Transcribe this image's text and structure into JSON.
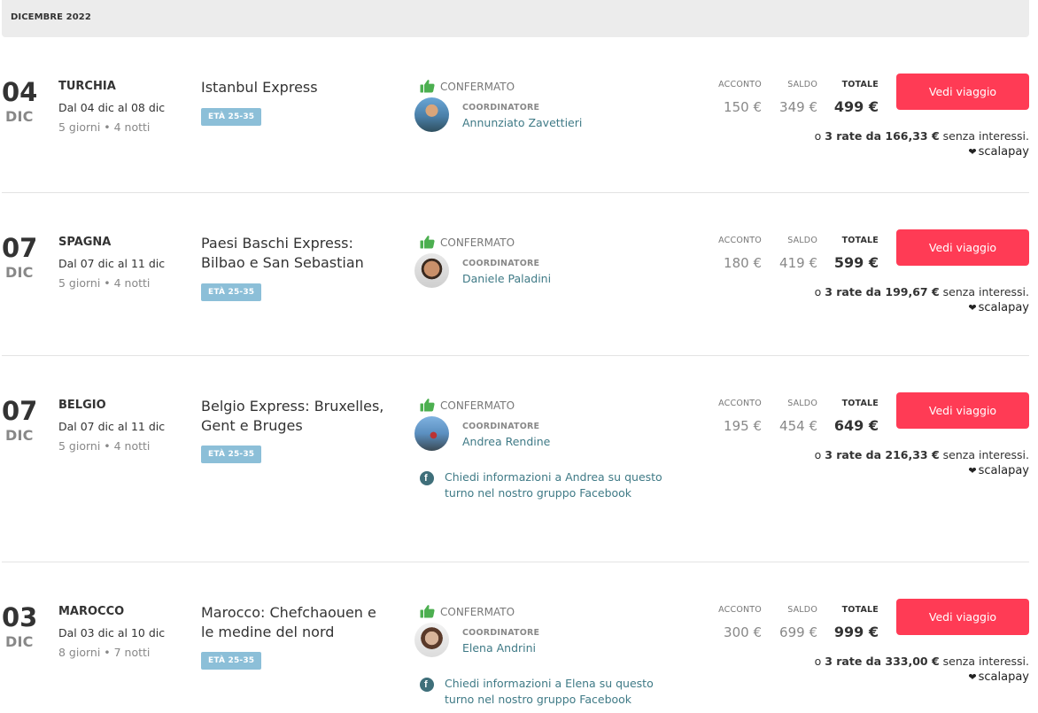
{
  "month_header": "DICEMBRE 2022",
  "labels": {
    "status": "CONFERMATO",
    "coordinator": "COORDINATORE",
    "deposit": "ACCONTO",
    "balance": "SALDO",
    "total": "TOTALE",
    "cta": "Vedi viaggio",
    "installments_prefix": "o ",
    "installments_suffix": " senza interessi.",
    "provider": "scalapay"
  },
  "trips": [
    {
      "day": "04",
      "month": "DIC",
      "country": "TURCHIA",
      "range": "Dal 04 dic al 08 dic",
      "duration": "5 giorni • 4 notti",
      "title": "Istanbul Express",
      "age": "ETÀ 25-35",
      "coordinator": "Annunziato Zavettieri",
      "deposit": "150 €",
      "balance": "349 €",
      "total": "499 €",
      "installments": "3 rate da 166,33 €",
      "fb_info": ""
    },
    {
      "day": "07",
      "month": "DIC",
      "country": "SPAGNA",
      "range": "Dal 07 dic al 11 dic",
      "duration": "5 giorni • 4 notti",
      "title": "Paesi Baschi Express: Bilbao e San Sebastian",
      "age": "ETÀ 25-35",
      "coordinator": "Daniele Paladini",
      "deposit": "180 €",
      "balance": "419 €",
      "total": "599 €",
      "installments": "3 rate da 199,67 €",
      "fb_info": ""
    },
    {
      "day": "07",
      "month": "DIC",
      "country": "BELGIO",
      "range": "Dal 07 dic al 11 dic",
      "duration": "5 giorni • 4 notti",
      "title": "Belgio Express: Bruxelles, Gent e Bruges",
      "age": "ETÀ 25-35",
      "coordinator": "Andrea Rendine",
      "deposit": "195 €",
      "balance": "454 €",
      "total": "649 €",
      "installments": "3 rate da 216,33 €",
      "fb_info": "Chiedi informazioni a Andrea su questo turno nel nostro gruppo Facebook"
    },
    {
      "day": "03",
      "month": "DIC",
      "country": "MAROCCO",
      "range": "Dal 03 dic al 10 dic",
      "duration": "8 giorni • 7 notti",
      "title": "Marocco: Chefchaouen e le medine del nord",
      "age": "ETÀ 25-35",
      "coordinator": "Elena Andrini",
      "deposit": "300 €",
      "balance": "699 €",
      "total": "999 €",
      "installments": "3 rate da 333,00 €",
      "fb_info": "Chiedi informazioni a Elena su questo turno nel nostro gruppo Facebook"
    }
  ],
  "colors": {
    "accent": "#ff3b55",
    "link": "#3f7a86",
    "badge": "#8cbfd8",
    "confirmed": "#4caf50"
  }
}
